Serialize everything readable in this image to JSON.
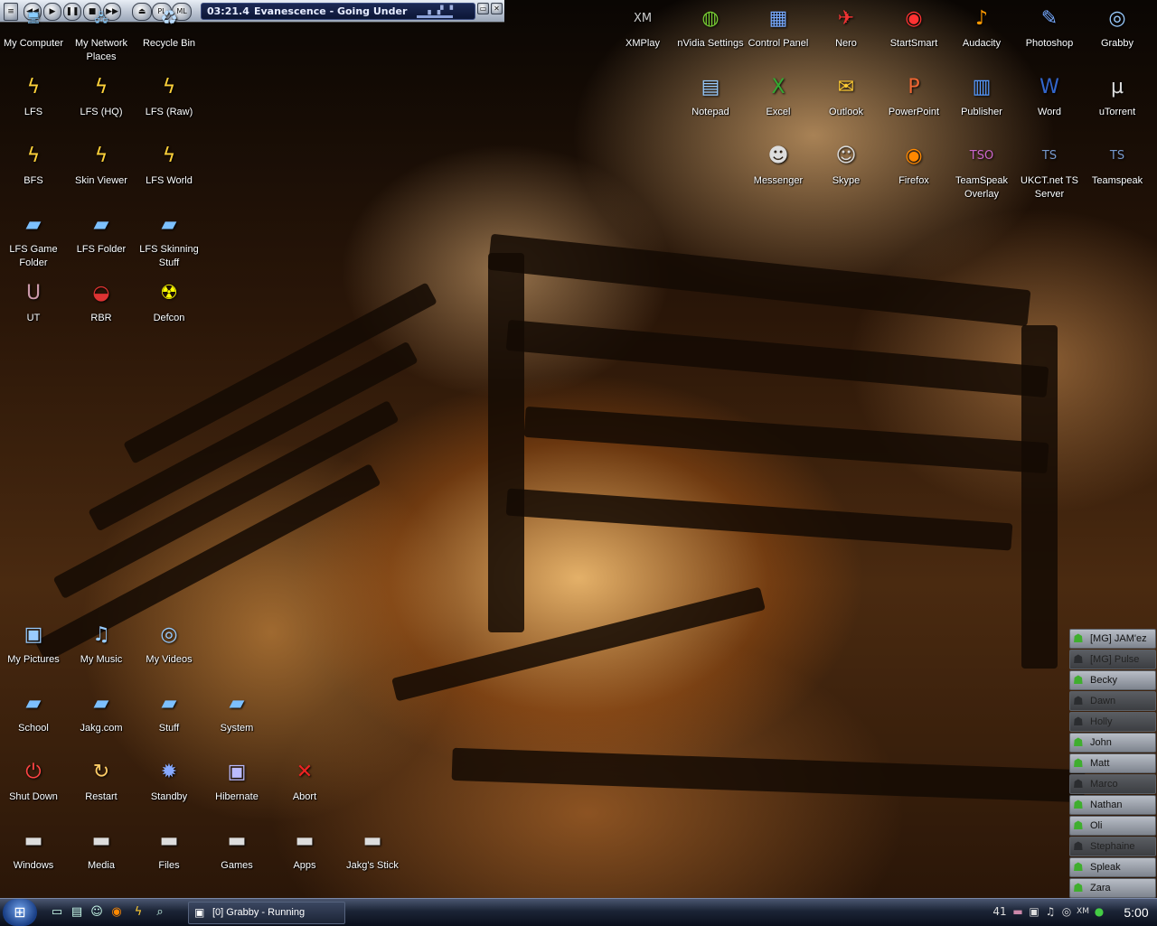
{
  "player": {
    "time": "03:21.4",
    "song": "Evanescence - Going Under",
    "buttons": [
      "◀◀",
      "▶",
      "❚❚",
      "■",
      "▶▶"
    ],
    "pl": "PL",
    "ml": "ML"
  },
  "desktop_left": [
    {
      "label": "My Computer",
      "icon": "computer-icon"
    },
    {
      "label": "My Network Places",
      "icon": "network-icon"
    },
    {
      "label": "Recycle Bin",
      "icon": "recycle-bin-icon"
    },
    {
      "label": "LFS",
      "icon": "lfs-icon"
    },
    {
      "label": "LFS (HQ)",
      "icon": "lfs-icon"
    },
    {
      "label": "LFS (Raw)",
      "icon": "lfs-icon"
    },
    {
      "label": "BFS",
      "icon": "lfs-icon"
    },
    {
      "label": "Skin Viewer",
      "icon": "lfs-icon"
    },
    {
      "label": "LFS World",
      "icon": "lfs-icon"
    },
    {
      "label": "LFS Game Folder",
      "icon": "folder-icon"
    },
    {
      "label": "LFS Folder",
      "icon": "folder-icon"
    },
    {
      "label": "LFS Skinning Stuff",
      "icon": "folder-icon"
    },
    {
      "label": "UT",
      "icon": "unreal-icon"
    },
    {
      "label": "RBR",
      "icon": "helmet-icon"
    },
    {
      "label": "Defcon",
      "icon": "radiation-icon"
    }
  ],
  "desktop_right": [
    {
      "label": "XMPlay",
      "icon": "xmplay-icon"
    },
    {
      "label": "nVidia Settings",
      "icon": "nvidia-icon"
    },
    {
      "label": "Control Panel",
      "icon": "control-panel-icon"
    },
    {
      "label": "Nero",
      "icon": "nero-icon"
    },
    {
      "label": "StartSmart",
      "icon": "startsmart-icon"
    },
    {
      "label": "Audacity",
      "icon": "audacity-icon"
    },
    {
      "label": "Photoshop",
      "icon": "photoshop-icon"
    },
    {
      "label": "Grabby",
      "icon": "grabby-icon"
    },
    {
      "label": "Notepad",
      "icon": "notepad-icon"
    },
    {
      "label": "Excel",
      "icon": "excel-icon"
    },
    {
      "label": "Outlook",
      "icon": "outlook-icon"
    },
    {
      "label": "PowerPoint",
      "icon": "powerpoint-icon"
    },
    {
      "label": "Publisher",
      "icon": "publisher-icon"
    },
    {
      "label": "Word",
      "icon": "word-icon"
    },
    {
      "label": "uTorrent",
      "icon": "utorrent-icon"
    },
    {
      "label": "Messenger",
      "icon": "messenger-icon"
    },
    {
      "label": "Skype",
      "icon": "skype-icon"
    },
    {
      "label": "Firefox",
      "icon": "firefox-icon"
    },
    {
      "label": "TeamSpeak Overlay",
      "icon": "teamspeak-overlay-icon"
    },
    {
      "label": "UKCT.net TS Server",
      "icon": "teamspeak-icon"
    },
    {
      "label": "Teamspeak",
      "icon": "teamspeak-icon"
    }
  ],
  "desktop_bottom": [
    {
      "label": "My Pictures",
      "icon": "pictures-icon"
    },
    {
      "label": "My Music",
      "icon": "music-icon"
    },
    {
      "label": "My Videos",
      "icon": "videos-icon"
    },
    {
      "label": "School",
      "icon": "folder-icon"
    },
    {
      "label": "Jakg.com",
      "icon": "folder-icon"
    },
    {
      "label": "Stuff",
      "icon": "folder-icon"
    },
    {
      "label": "System",
      "icon": "folder-icon"
    },
    {
      "label": "Shut Down",
      "icon": "power-icon"
    },
    {
      "label": "Restart",
      "icon": "restart-icon"
    },
    {
      "label": "Standby",
      "icon": "standby-icon"
    },
    {
      "label": "Hibernate",
      "icon": "hibernate-icon"
    },
    {
      "label": "Abort",
      "icon": "abort-icon"
    },
    {
      "label": "Windows",
      "icon": "drive-icon"
    },
    {
      "label": "Media",
      "icon": "drive-icon"
    },
    {
      "label": "Files",
      "icon": "drive-icon"
    },
    {
      "label": "Games",
      "icon": "drive-icon"
    },
    {
      "label": "Apps",
      "icon": "drive-icon"
    },
    {
      "label": "Jakg's Stick",
      "icon": "usb-drive-icon"
    }
  ],
  "buddies": [
    {
      "name": "[MG] JAM'ez",
      "online": true
    },
    {
      "name": "[MG] Pulse",
      "online": false
    },
    {
      "name": "Becky",
      "online": true
    },
    {
      "name": "Dawn",
      "online": false
    },
    {
      "name": "Holly",
      "online": false
    },
    {
      "name": "John",
      "online": true
    },
    {
      "name": "Matt",
      "online": true
    },
    {
      "name": "Marco",
      "online": false
    },
    {
      "name": "Nathan",
      "online": true
    },
    {
      "name": "Oli",
      "online": true
    },
    {
      "name": "Stephaine",
      "online": false
    },
    {
      "name": "Spleak",
      "online": true
    },
    {
      "name": "Zara",
      "online": true
    }
  ],
  "taskbar": {
    "task_label": "[0] Grabby - Running",
    "tray_number": "41",
    "clock": "5:00"
  }
}
